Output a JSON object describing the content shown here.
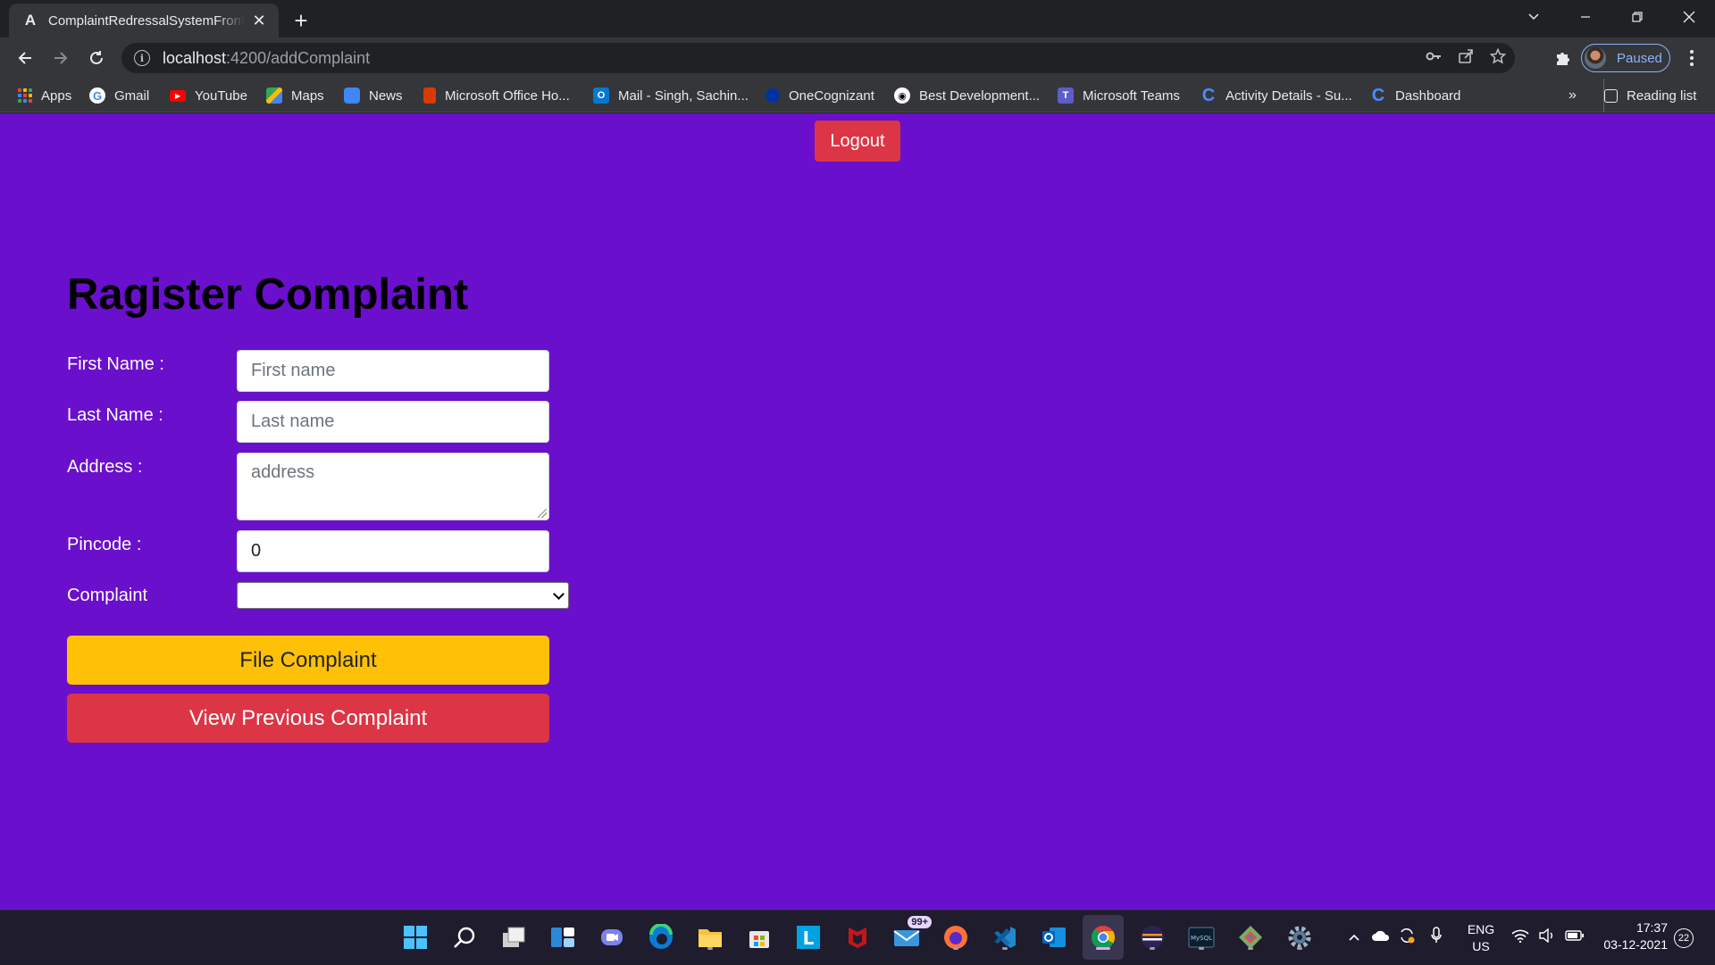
{
  "browser": {
    "tab_title": "ComplaintRedressalSystemFrontend",
    "url_host": "localhost",
    "url_path": ":4200/addComplaint",
    "profile_label": "Paused",
    "bookmarks": [
      {
        "label": "Apps",
        "icon": "apps-grid-icon"
      },
      {
        "label": "Gmail",
        "icon": "google-icon"
      },
      {
        "label": "YouTube",
        "icon": "youtube-icon"
      },
      {
        "label": "Maps",
        "icon": "maps-icon"
      },
      {
        "label": "News",
        "icon": "news-icon"
      },
      {
        "label": "Microsoft Office Ho...",
        "icon": "office-icon"
      },
      {
        "label": "Mail - Singh, Sachin...",
        "icon": "outlook-icon"
      },
      {
        "label": "OneCognizant",
        "icon": "cognizant-icon"
      },
      {
        "label": "Best Development...",
        "icon": "github-icon"
      },
      {
        "label": "Microsoft Teams",
        "icon": "teams-icon"
      },
      {
        "label": "Activity Details - Su...",
        "icon": "c-icon"
      },
      {
        "label": "Dashboard",
        "icon": "c-icon"
      }
    ],
    "more_bookmarks": "»",
    "reading_list": "Reading list"
  },
  "page": {
    "logout_label": "Logout",
    "title": "Ragister Complaint",
    "form": {
      "first_name_label": "First Name :",
      "first_name_placeholder": "First name",
      "last_name_label": "Last Name :",
      "last_name_placeholder": "Last name",
      "address_label": "Address :",
      "address_placeholder": "address",
      "pincode_label": "Pincode :",
      "pincode_value": "0",
      "complaint_label": "Complaint",
      "complaint_selected": ""
    },
    "file_button": "File Complaint",
    "view_button": "View Previous Complaint"
  },
  "taskbar": {
    "mail_badge": "99+",
    "language": "ENG",
    "region": "US",
    "time": "17:37",
    "date": "03-12-2021",
    "notifications": "22"
  },
  "colors": {
    "page_background": "#6a0fcc",
    "logout_button": "#dc3545",
    "file_button": "#ffc107",
    "view_button": "#dc3545"
  }
}
